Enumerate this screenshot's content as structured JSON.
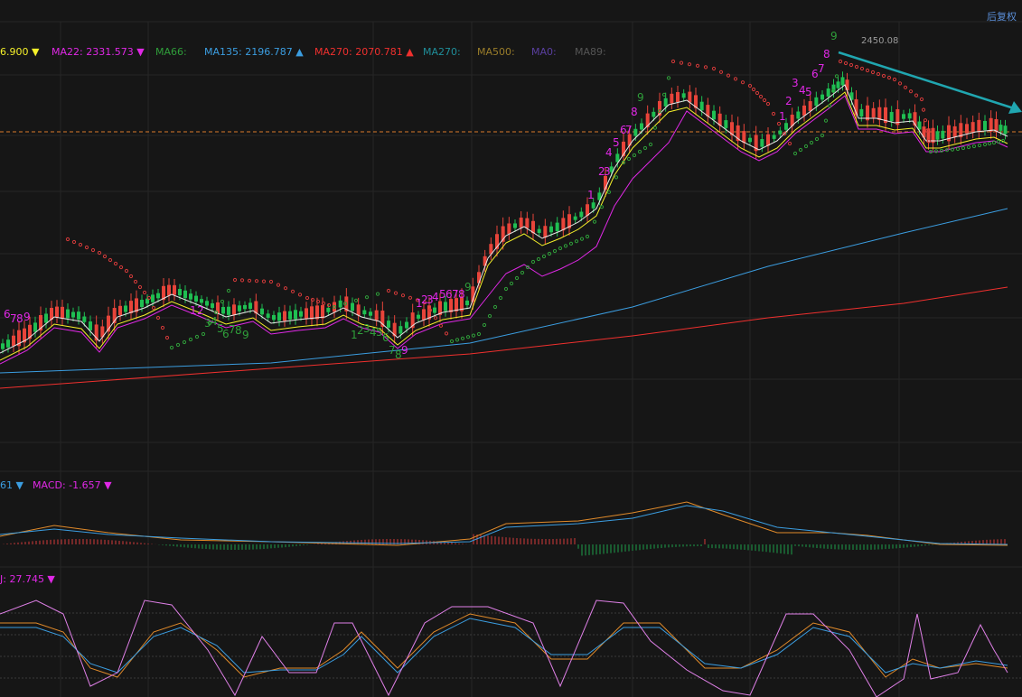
{
  "toolbar": {
    "adjust_label": "后复权"
  },
  "panels": {
    "main": {
      "ma_legend": [
        {
          "text": "6.900",
          "color": "#f5f02a",
          "arrow": "▼"
        },
        {
          "text": "MA22:",
          "value": "2331.573",
          "color": "#e028e6",
          "arrow": "▼"
        },
        {
          "text": "MA66:",
          "value": "",
          "color": "#2f9e3a",
          "arrow": ""
        },
        {
          "text": "MA135:",
          "value": "2196.787",
          "color": "#3b9de0",
          "arrow": "▲"
        },
        {
          "text": "MA270:",
          "value": "2070.781",
          "color": "#f0302e",
          "arrow": "▲"
        },
        {
          "text": "MA270:",
          "value": "",
          "color": "#1f8e9a",
          "arrow": ""
        },
        {
          "text": "MA500:",
          "value": "",
          "color": "#9a7d2a",
          "arrow": ""
        },
        {
          "text": "MA0:",
          "value": "",
          "color": "#5a3fa0",
          "arrow": ""
        },
        {
          "text": "MA89:",
          "value": "",
          "color": "#555555",
          "arrow": ""
        }
      ],
      "peak_label": "2450.08"
    },
    "macd": {
      "legend": [
        {
          "text": "61",
          "color": "#3b9de0",
          "arrow": "▼"
        },
        {
          "text": "MACD:",
          "value": "-1.657",
          "color": "#e028e6",
          "arrow": "▼"
        }
      ]
    },
    "kdj": {
      "legend": [
        {
          "text": "J:",
          "value": "27.745",
          "color": "#e028e6",
          "arrow": "▼"
        }
      ]
    }
  },
  "chart_data": {
    "type": "candlestick",
    "note_series": "price panel with moving averages, TD sequential counts, SAR dots; MACD and KDJ sub panels",
    "current_price": 2325,
    "peak_price": 2450.08,
    "ma_values": {
      "MA22": 2331.573,
      "MA135": 2196.787,
      "MA270": 2070.781
    },
    "macd_value": -1.657,
    "kdj_j": 27.745,
    "colors": {
      "up": "#e8443a",
      "down": "#1fbf52",
      "background": "#161616",
      "grid": "#2a2a2a"
    }
  }
}
